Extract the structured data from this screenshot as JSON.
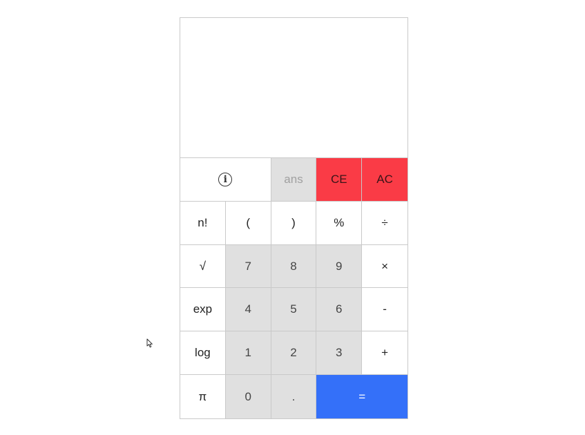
{
  "display": {
    "value": ""
  },
  "keys": {
    "info_icon": "i",
    "ans": "ans",
    "ce": "CE",
    "ac": "AC",
    "factorial": "n!",
    "paren_open": "(",
    "paren_close": ")",
    "percent": "%",
    "divide": "÷",
    "sqrt": "√",
    "seven": "7",
    "eight": "8",
    "nine": "9",
    "multiply": "×",
    "exp": "exp",
    "four": "4",
    "five": "5",
    "six": "6",
    "minus": "-",
    "log": "log",
    "one": "1",
    "two": "2",
    "three": "3",
    "plus": "+",
    "pi": "π",
    "zero": "0",
    "decimal": ".",
    "equals": "="
  },
  "colors": {
    "danger": "#fa3b46",
    "equals": "#3470f9",
    "number_key": "#e0e0e0",
    "border": "#c9c9c9"
  },
  "icons": {
    "info": "info-icon",
    "cursor": "mouse-pointer-icon"
  }
}
